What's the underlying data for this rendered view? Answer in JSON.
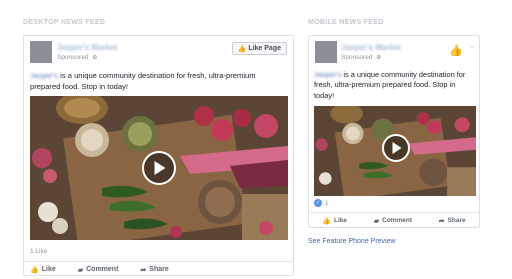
{
  "desktop": {
    "section_label": "DESKTOP NEWS FEED",
    "page_name": "Jasper's Market",
    "sponsored": "Sponsored",
    "like_page_label": "Like Page",
    "text_name": "Jasper's",
    "text_rest": " is a unique community destination for fresh, ultra-premium prepared food. Stop in today!",
    "likes_count": "1 Like",
    "actions": {
      "like": "Like",
      "comment": "Comment",
      "share": "Share"
    }
  },
  "mobile": {
    "section_label": "MOBILE NEWS FEED",
    "page_name": "Jasper's Market",
    "sponsored": "Sponsored",
    "text_name": "Jasper's",
    "text_rest": " is a unique community destination for fresh, ultra-premium prepared food. Stop in today!",
    "likes_count": "1",
    "actions": {
      "like": "Like",
      "comment": "Comment",
      "share": "Share"
    }
  },
  "feature_phone_link": "See Feature Phone Preview",
  "colors": {
    "link": "#4267b2",
    "like_blue": "#5890ff",
    "border": "#dddfe2"
  },
  "icons": [
    "thumbs-up-icon",
    "globe-icon",
    "play-icon",
    "comment-icon",
    "share-icon",
    "chevron-down-icon"
  ]
}
